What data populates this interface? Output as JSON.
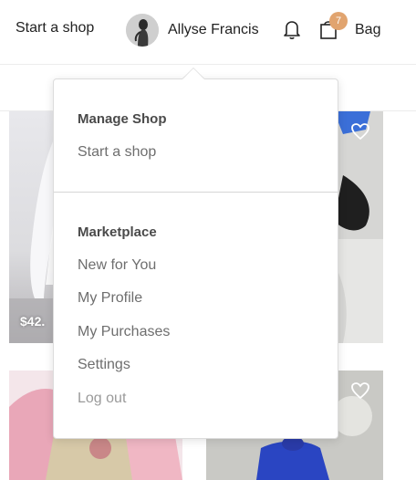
{
  "topbar": {
    "start_shop_label": "Start a shop",
    "user_name": "Allyse Francis",
    "bag_count": "7",
    "bag_label": "Bag",
    "badge_color": "#e1a46f"
  },
  "products": [
    {
      "price": "$42.",
      "liked": false
    },
    {
      "price": "",
      "liked": false
    },
    {
      "price": "",
      "liked": false
    },
    {
      "price": "",
      "liked": false
    }
  ],
  "dropdown": {
    "manage_heading": "Manage Shop",
    "manage_items": [
      "Start a shop"
    ],
    "marketplace_heading": "Marketplace",
    "marketplace_items": [
      "New for You",
      "My Profile",
      "My Purchases",
      "Settings"
    ],
    "logout_label": "Log out"
  },
  "icons": {
    "bell": "bell-icon",
    "bag": "shopping-bag-icon",
    "heart": "heart-icon"
  }
}
